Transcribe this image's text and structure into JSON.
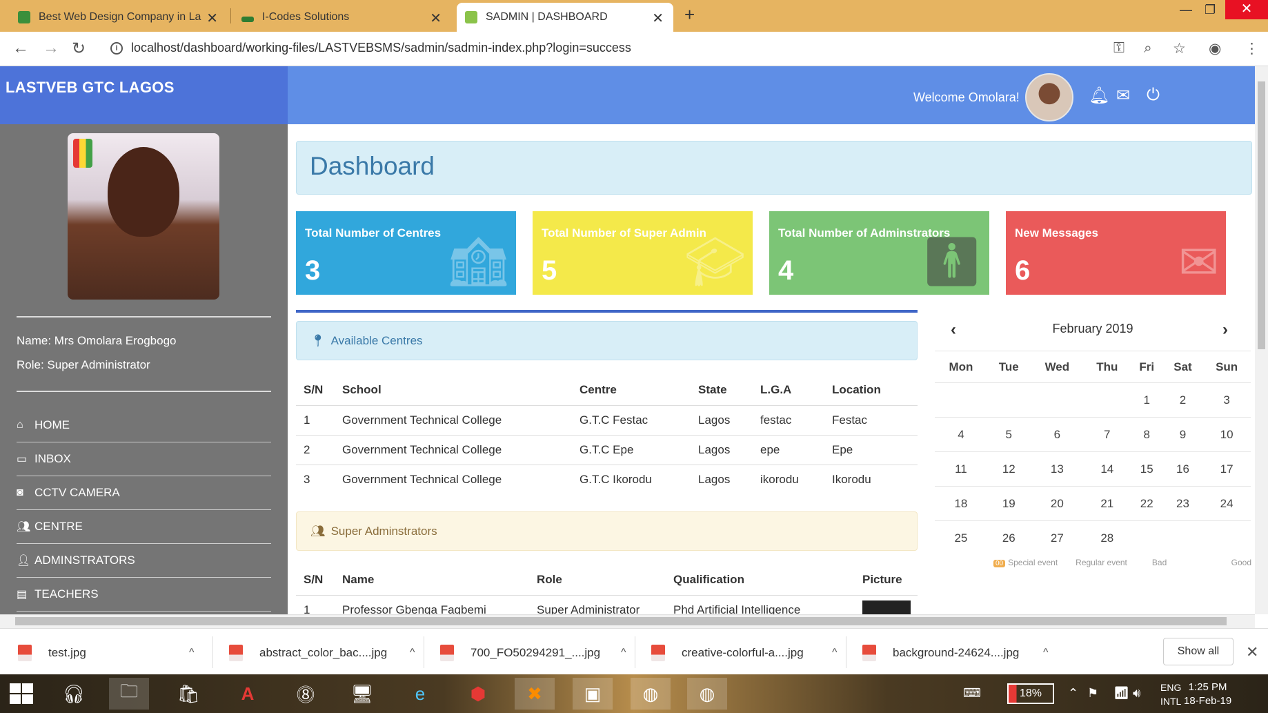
{
  "browser": {
    "tabs": [
      {
        "title": "Best Web Design Company in La"
      },
      {
        "title": "I-Codes Solutions"
      },
      {
        "title": "SADMIN | DASHBOARD"
      }
    ],
    "url": "localhost/dashboard/working-files/LASTVEBSMS/sadmin/sadmin-index.php?login=success"
  },
  "app": {
    "brand": "LASTVEB GTC LAGOS",
    "welcome": "Welcome Omolara!",
    "profile": {
      "name": "Name: Mrs Omolara Erogbogo",
      "role": "Role: Super Administrator"
    },
    "nav": [
      "HOME",
      "INBOX",
      "CCTV CAMERA",
      "CENTRE",
      "ADMINSTRATORS",
      "TEACHERS"
    ],
    "page_title": "Dashboard",
    "cards": [
      {
        "label": "Total Number of Centres",
        "value": "3",
        "color": "#31a7dc"
      },
      {
        "label": "Total Number of Super Admin",
        "value": "5",
        "color": "#f4e94a"
      },
      {
        "label": "Total Number of Adminstrators",
        "value": "4",
        "color": "#7cc576"
      },
      {
        "label": "New Messages",
        "value": "6",
        "color": "#ea5a5a"
      }
    ],
    "centres": {
      "heading": "Available Centres",
      "columns": [
        "S/N",
        "School",
        "Centre",
        "State",
        "L.G.A",
        "Location"
      ],
      "rows": [
        [
          "1",
          "Government Technical College",
          "G.T.C Festac",
          "Lagos",
          "festac",
          "Festac"
        ],
        [
          "2",
          "Government Technical College",
          "G.T.C Epe",
          "Lagos",
          "epe",
          "Epe"
        ],
        [
          "3",
          "Government Technical College",
          "G.T.C Ikorodu",
          "Lagos",
          "ikorodu",
          "Ikorodu"
        ]
      ]
    },
    "super_admins": {
      "heading": "Super Adminstrators",
      "columns": [
        "S/N",
        "Name",
        "Role",
        "Qualification",
        "Picture"
      ],
      "rows": [
        [
          "1",
          "Professor Gbenga Fagbemi",
          "Super Administrator",
          "Phd Artificial Intelligence"
        ]
      ]
    },
    "calendar": {
      "month": "February 2019",
      "days": [
        "Mon",
        "Tue",
        "Wed",
        "Thu",
        "Fri",
        "Sat",
        "Sun"
      ],
      "weeks": [
        [
          "",
          "",
          "",
          "",
          "1",
          "2",
          "3"
        ],
        [
          "4",
          "5",
          "6",
          "7",
          "8",
          "9",
          "10"
        ],
        [
          "11",
          "12",
          "13",
          "14",
          "15",
          "16",
          "17"
        ],
        [
          "18",
          "19",
          "20",
          "21",
          "22",
          "23",
          "24"
        ],
        [
          "25",
          "26",
          "27",
          "28",
          "",
          "",
          ""
        ]
      ],
      "legend": {
        "badge": "00",
        "special": "Special event",
        "regular": "Regular event",
        "bad": "Bad",
        "good": "Good"
      }
    }
  },
  "downloads": {
    "files": [
      "test.jpg",
      "abstract_color_bac....jpg",
      "700_FO50294291_....jpg",
      "creative-colorful-a....jpg",
      "background-24624....jpg"
    ],
    "show_all": "Show all"
  },
  "taskbar": {
    "battery": "18%",
    "lang": [
      "ENG",
      "INTL"
    ],
    "time": "1:25 PM",
    "date": "18-Feb-19"
  }
}
